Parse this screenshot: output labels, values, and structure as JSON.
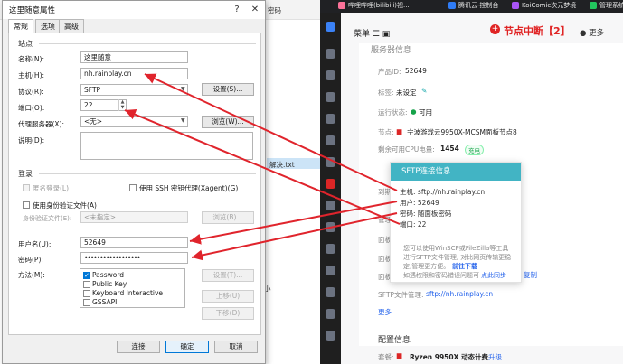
{
  "background_explorer": {
    "tab_text": "密码",
    "file_name": "解决.txt",
    "fragment": "小"
  },
  "dialog": {
    "title": "这里随意属性",
    "help_btn": "?",
    "close_btn": "✕",
    "tabs": [
      "常规",
      "选项",
      "高级"
    ],
    "site_group": "站点",
    "name_label": "名称(N):",
    "name_value": "这里随意",
    "host_label": "主机(H):",
    "host_value": "nh.rainplay.cn",
    "protocol_label": "协议(R):",
    "protocol_value": "SFTP",
    "settings_btn": "设置(S)...",
    "port_label": "端口(O):",
    "port_value": "22",
    "proxy_label": "代理服务器(X):",
    "proxy_value": "<无>",
    "browse_btn": "浏览(W)...",
    "desc_label": "说明(D):",
    "login_group": "登录",
    "anon_label": "匿名登录(L)",
    "ssh_agent_label": "使用 SSH 密钥代理(Xagent)(G)",
    "use_auth_file_label": "使用身份验证文件(A)",
    "auth_file_label": "身份验证文件(E):",
    "auth_file_value": "<未指定>",
    "browse2_btn": "浏览(B)...",
    "user_label": "用户名(U):",
    "user_value": "52649",
    "pass_label": "密码(P):",
    "pass_value": "••••••••••••••••••",
    "method_label": "方法(M):",
    "methods": [
      "Password",
      "Public Key",
      "Keyboard Interactive",
      "GSSAPI"
    ],
    "method_settings_btn": "设置(T)...",
    "up_btn": "上移(U)",
    "down_btn": "下移(D)",
    "connect_btn": "连接",
    "ok_btn": "确定",
    "cancel_btn": "取消"
  },
  "browser": {
    "tabs": [
      "哔哩哔哩(bilibili)视...",
      "腾讯云-控制台",
      "KoiComic次元梦境",
      "管理系统"
    ],
    "menu_label": "菜单",
    "node_status": "节点中断【2】",
    "more": "更多",
    "section_title": "服务器信息",
    "product_id_label": "产品ID:",
    "product_id_value": "52649",
    "tag_label": "标签:",
    "tag_value": "未设定",
    "run_state_label": "运行状态:",
    "run_state_value": "可用",
    "node_label": "节点:",
    "node_value": "宁波游戏云9950X-MCSM面板节点8",
    "cpu_label": "剩余可用CPU电量:",
    "cpu_value": "1454",
    "recharge_chip": "充电",
    "expire_label": "到期",
    "manage_label": "管理",
    "panel_label1": "面板",
    "panel_label2": "面板",
    "panel_label3": "面板",
    "copy_link": "复制",
    "sftp_file_label": "SFTP文件管理:",
    "sftp_file_value": "sftp://nh.rainplay.cn",
    "more_link": "更多",
    "config_section": "配置信息",
    "package_label": "套餐:",
    "package_value": "Ryzen 9950X 动态计费",
    "upgrade_link": "升级"
  },
  "sftp_popup": {
    "header": "SFTP连接信息",
    "host": "主机: sftp://nh.rainplay.cn",
    "user": "用户: 52649",
    "password": "密码: 随面板密码",
    "port": "端口: 22",
    "note1": "您可以使用WinSCP或FileZilla等工具",
    "note2": "进行SFTP文件管理, 对比网页传输更稳",
    "note3": "定,管理更方便。",
    "download_link": "前往下载",
    "note4": "如遇权限和密码错误问题可",
    "sync_link": "点此同步"
  },
  "colors": {
    "accent_blue": "#0078d7",
    "popup_header": "#42b4c4",
    "arrow_red": "#e0242c",
    "status_green": "#16a34a"
  }
}
